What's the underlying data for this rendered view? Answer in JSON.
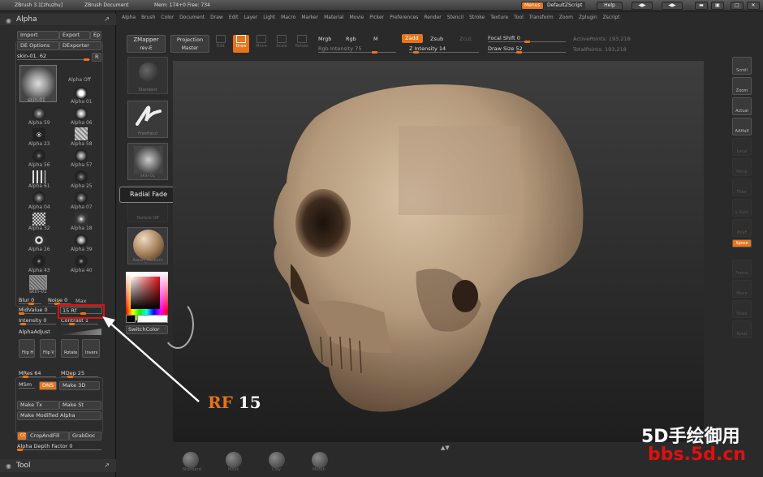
{
  "titlebar": {
    "app": "ZBrush 3.1[zhuzhu]",
    "document": "ZBrush Document",
    "mem": "Mem: 174+0 Free: 734",
    "menus_btn": "Menus",
    "script_btn": "DefaultZScript",
    "help_btn": "Help"
  },
  "menus": [
    "Alpha",
    "Brush",
    "Color",
    "Document",
    "Draw",
    "Edit",
    "Layer",
    "Light",
    "Macro",
    "Marker",
    "Material",
    "Movie",
    "Picker",
    "Preferences",
    "Render",
    "Stencil",
    "Stroke",
    "Texture",
    "Tool",
    "Transform",
    "Zoom",
    "Zplugin",
    "Zscript"
  ],
  "alpha_panel": {
    "title": "Alpha",
    "import": "Import",
    "export": "Export",
    "ep": "Ep",
    "de_options": "DE Options",
    "dexporter": "DExporter",
    "current": "skin-01. 62",
    "r": "R",
    "current_caption": "skin-01",
    "alpha_off": "Alpha Off",
    "items": [
      "Alpha 01",
      "Alpha 59",
      "Alpha 06",
      "Alpha 23",
      "Alpha 58",
      "Alpha 56",
      "Alpha 57",
      "Alpha 61",
      "Alpha 25",
      "Alpha 04",
      "Alpha 07",
      "Alpha 32",
      "Alpha 18",
      "Alpha 26",
      "Alpha 39",
      "Alpha 43",
      "Alpha 40"
    ],
    "last_caption": "skin-01",
    "blur": "Blur 0",
    "noise": "Noise 0",
    "max": "Max",
    "midvalue": "MidValue 0",
    "rf": "15 Rf",
    "intensity": "Intensity 0",
    "contrast": "Contrast 1",
    "alphaadjust": "AlphaAdjust",
    "flip_h": "Flip H",
    "flip_v": "Flip V",
    "rotate": "Rotate",
    "invers": "Invers",
    "mres": "MRes 64",
    "mdep": "MDep 25",
    "msm": "MSm",
    "dns": "DNS",
    "make3d": "Make 3D",
    "make_tx": "Make Tx",
    "make_st": "Make St",
    "make_modified": "Make Modified Alpha",
    "cropandfill": "CropAndFill",
    "grabdoc": "GrabDoc",
    "cc": "CC",
    "alpha_depth": "Alpha Depth Factor 0",
    "tool_title": "Tool"
  },
  "top_toolbar": {
    "zmapper": "ZMapper",
    "zmapper_sub": "rev-E",
    "projection": "Projection",
    "projection_sub": "Master",
    "tools": [
      "Edit",
      "Draw",
      "Move",
      "Scale",
      "Rotate"
    ],
    "mrgb": "Mrgb",
    "rgb": "Rgb",
    "m": "M",
    "rgb_intensity": "Rgb Intensity 75",
    "zadd": "Zadd",
    "zsub": "Zsub",
    "zcut": "Zcut",
    "z_intensity": "Z Intensity 14",
    "focal_shift": "Focal Shift 0",
    "draw_size": "Draw Size 52",
    "active_points": "ActivePoints: 193,218",
    "total_points": "TotalPoints: 193,218"
  },
  "middle_shelf": {
    "items": [
      "Standard",
      "FreeHand",
      "skin-01",
      "Texture Off",
      "Aaron_Medium"
    ],
    "tooltip": "Radial Fade",
    "switchcolor": "SwitchColor"
  },
  "right_shelf": [
    "Scroll",
    "Zoom",
    "Actual",
    "AAHalf",
    "Local",
    "Persp",
    "Floor",
    "L.Sym",
    "PolyF",
    "Xpose",
    "Frame",
    "Move",
    "Scale",
    "Rotat"
  ],
  "bottom_shelf": [
    "Standard",
    "Move",
    "Clay",
    "Morph"
  ],
  "annotation": {
    "rf": "RF",
    "value": "15"
  },
  "watermark": {
    "line1": "5D手绘御用",
    "line2": "bbs.5d.cn"
  },
  "colors": {
    "accent": "#e8741a",
    "highlight": "#e01010",
    "skull": "#b59a7c"
  }
}
